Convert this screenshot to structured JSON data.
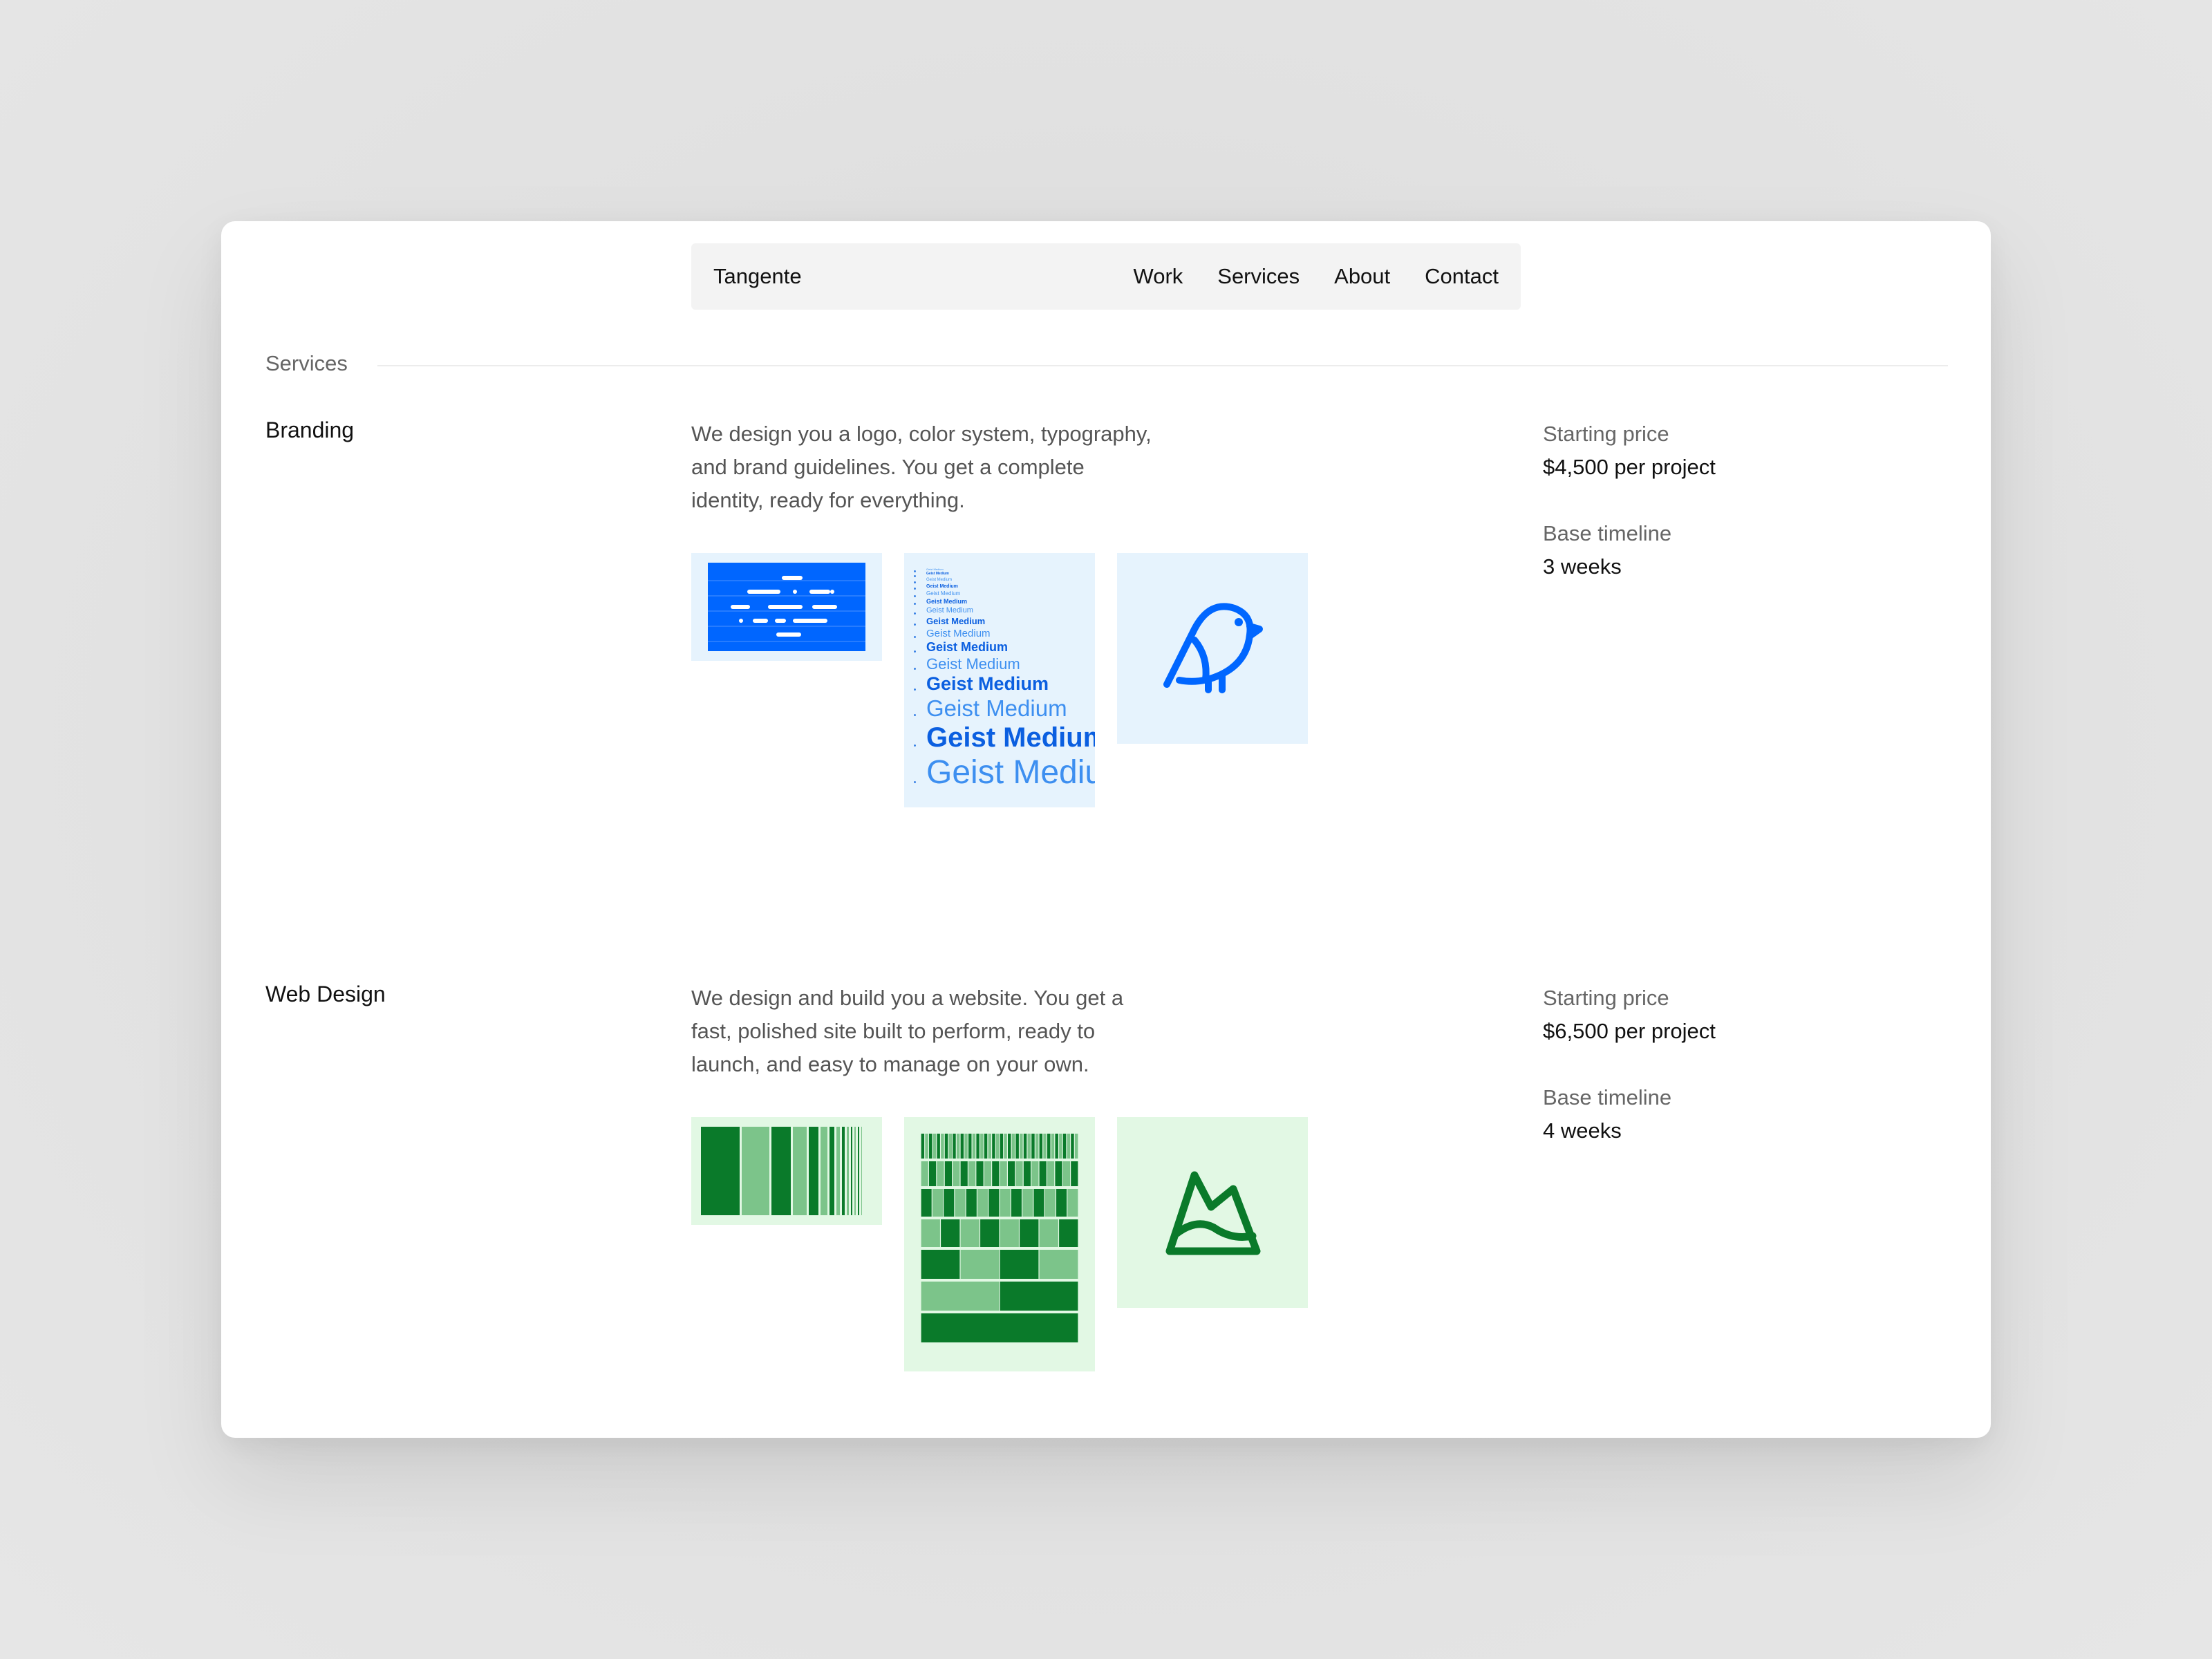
{
  "nav": {
    "brand": "Tangente",
    "links": [
      "Work",
      "Services",
      "About",
      "Contact"
    ]
  },
  "section_label": "Services",
  "services": [
    {
      "name": "Branding",
      "description": "We design you a logo, color system, typography, and brand guidelines. You get a complete identity, ready for everything.",
      "price_label": "Starting price",
      "price_value": "$4,500 per project",
      "timeline_label": "Base timeline",
      "timeline_value": "3 weeks",
      "type_specimen": "Geist Medium"
    },
    {
      "name": "Web Design",
      "description": "We design and build you a website. You get a fast, polished site built to perform, ready to launch, and easy to manage on your own.",
      "price_label": "Starting price",
      "price_value": "$6,500 per project",
      "timeline_label": "Base timeline",
      "timeline_value": "4 weeks"
    }
  ],
  "colors": {
    "brand_blue": "#0066ff",
    "brand_blue_light": "#e6f3fd",
    "brand_green": "#0a7a2a",
    "brand_green_mid": "#7cc48a",
    "brand_green_light": "#e2f8e4"
  },
  "icons": [
    "bird-icon",
    "mountain-icon"
  ]
}
